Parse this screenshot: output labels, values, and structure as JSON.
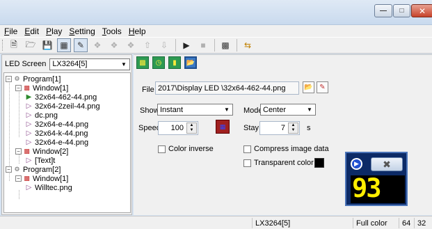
{
  "menu": {
    "items": [
      {
        "key": "F",
        "rest": "ile"
      },
      {
        "key": "E",
        "rest": "dit"
      },
      {
        "key": "P",
        "rest": "lay"
      },
      {
        "key": "S",
        "rest": "etting"
      },
      {
        "key": "T",
        "rest": "ools"
      },
      {
        "key": "H",
        "rest": "elp"
      }
    ]
  },
  "left_panel": {
    "led_screen_label": "LED Screen",
    "led_screen_value": "LX3264[5]",
    "tree": {
      "program1": "Program[1]",
      "window1": "Window[1]",
      "file1": "32x64-462-44.png",
      "file2": "32x64-2zeil-44.png",
      "file3": "dc.png",
      "file4": "32x64-e-44.png",
      "file5": "32x64-k-44.png",
      "file6": "32x64-e-44.png",
      "window2": "Window[2]",
      "text1": "[Text]t",
      "program2": "Program[2]",
      "window1b": "Window[1]",
      "file7": "Willtec.png"
    }
  },
  "properties": {
    "file_label": "File",
    "file_value": "2017\\Display LED \\32x64-462-44.png",
    "show_label": "Show",
    "show_value": "Instant",
    "mode_label": "Mode",
    "mode_value": "Center",
    "speed_label": "Speed",
    "speed_value": "100",
    "stay_label": "Stay",
    "stay_value": "7",
    "stay_unit": "s",
    "color_inverse_label": "Color inverse",
    "compress_label": "Compress image data",
    "transparent_label": "Transparent color",
    "transparent_color": "#000000"
  },
  "preview": {
    "digits": "93"
  },
  "status": {
    "screen": "LX3264[5]",
    "color_mode": "Full color",
    "width": "64",
    "height": "32"
  }
}
